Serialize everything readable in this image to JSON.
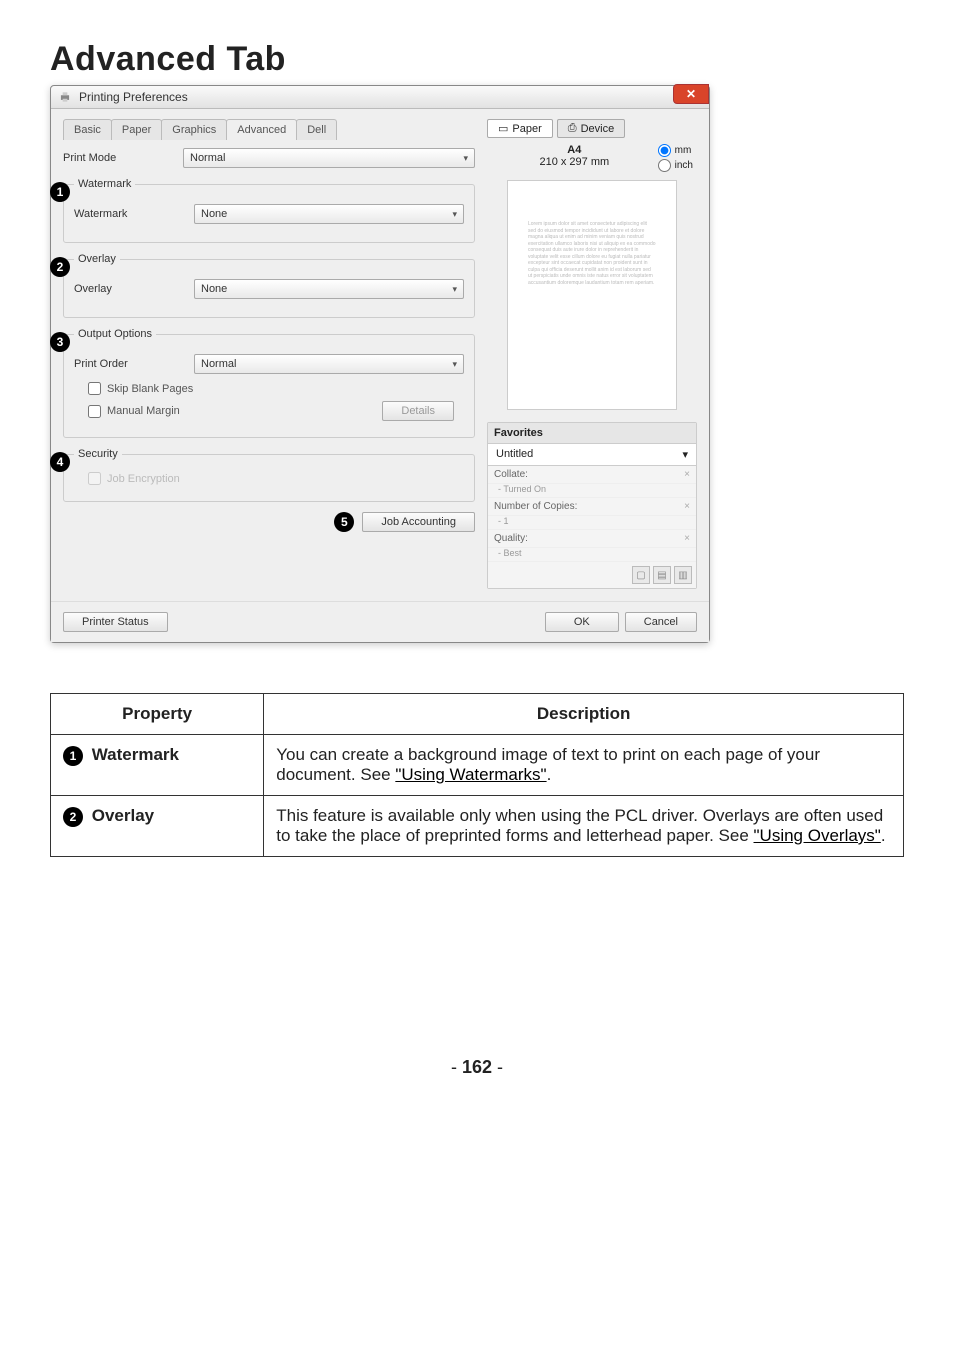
{
  "page": {
    "title": "Advanced Tab",
    "number": "162"
  },
  "dialog": {
    "window_title": "Printing Preferences",
    "tabs": [
      "Basic",
      "Paper",
      "Graphics",
      "Advanced",
      "Dell"
    ],
    "active_tab": "Advanced",
    "print_mode": {
      "label": "Print Mode",
      "value": "Normal"
    },
    "groups": {
      "watermark": {
        "legend": "Watermark",
        "row_label": "Watermark",
        "value": "None"
      },
      "overlay": {
        "legend": "Overlay",
        "row_label": "Overlay",
        "value": "None"
      },
      "output": {
        "legend": "Output Options",
        "print_order_label": "Print Order",
        "print_order_value": "Normal",
        "skip_blank_label": "Skip Blank Pages",
        "manual_margin_label": "Manual Margin",
        "details_btn": "Details"
      },
      "security": {
        "legend": "Security",
        "job_encryption_label": "Job Encryption"
      }
    },
    "job_accounting_btn": "Job Accounting",
    "right": {
      "paper_tab": "Paper",
      "device_tab": "Device",
      "paper_name": "A4",
      "paper_dims": "210 x 297 mm",
      "unit_mm": "mm",
      "unit_inch": "inch",
      "favorites": {
        "heading": "Favorites",
        "selected": "Untitled",
        "items": [
          {
            "label": "Collate:",
            "sub": "- Turned On"
          },
          {
            "label": "Number of Copies:",
            "sub": "- 1"
          },
          {
            "label": "Quality:",
            "sub": "- Best"
          }
        ]
      }
    },
    "bottom": {
      "printer_status": "Printer Status",
      "ok": "OK",
      "cancel": "Cancel"
    }
  },
  "table": {
    "headers": {
      "property": "Property",
      "description": "Description"
    },
    "rows": [
      {
        "num": "1",
        "name": "Watermark",
        "desc_pre": "You can create a background image of text to print on each page of your document. See ",
        "desc_link": "\"Using Watermarks\"",
        "desc_post": "."
      },
      {
        "num": "2",
        "name": "Overlay",
        "desc_pre": "This feature is available only when using the PCL driver. Overlays are often used to take the place of preprinted forms and letterhead paper. See ",
        "desc_link": "\"Using Overlays\"",
        "desc_post": "."
      }
    ]
  }
}
